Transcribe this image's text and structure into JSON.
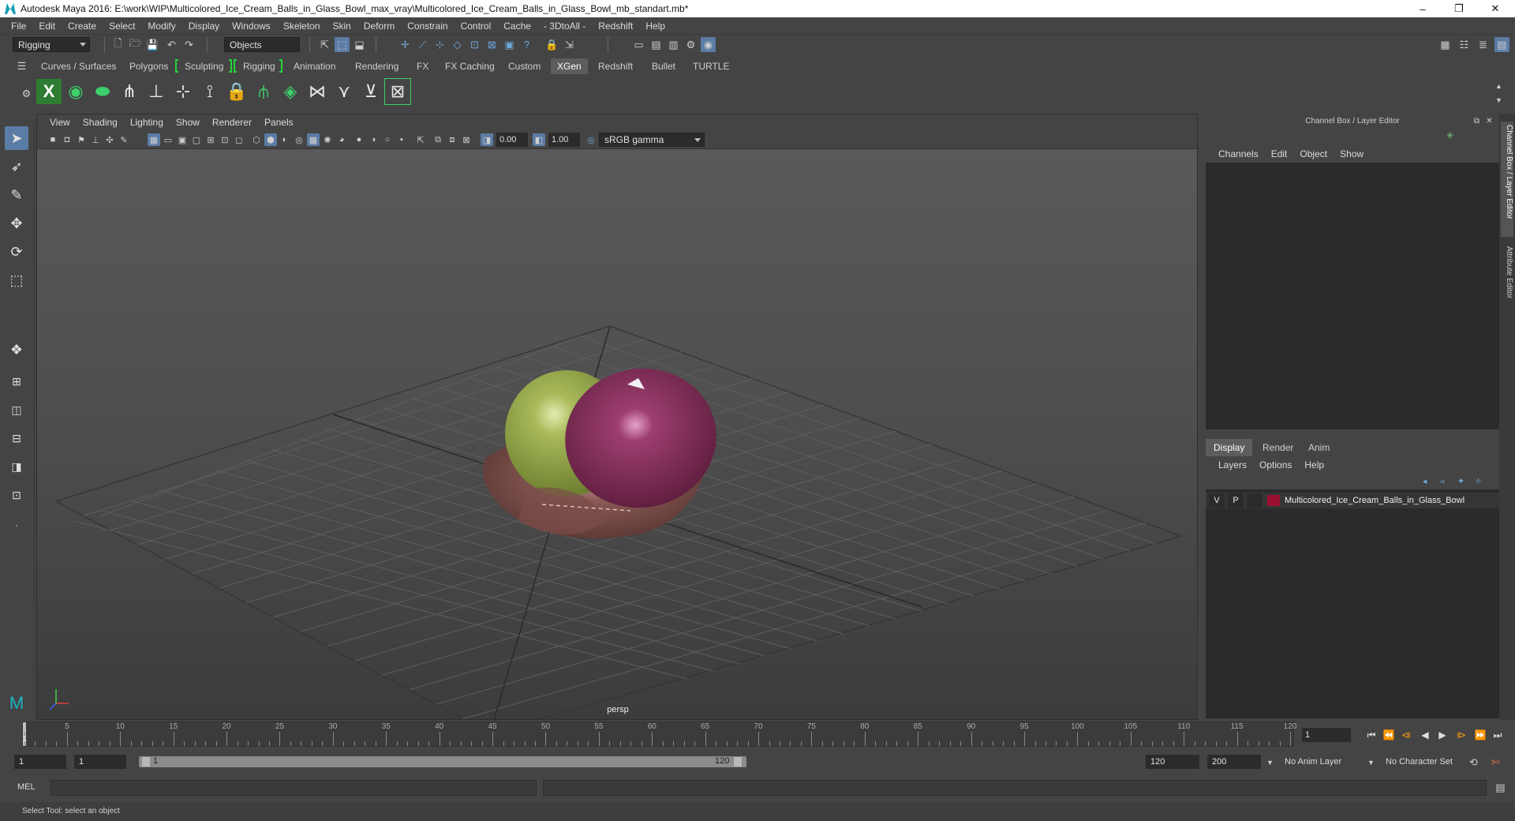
{
  "window": {
    "title": "Autodesk Maya 2016: E:\\work\\WIP\\Multicolored_Ice_Cream_Balls_in_Glass_Bowl_max_vray\\Multicolored_Ice_Cream_Balls_in_Glass_Bowl_mb_standart.mb*",
    "minimize": "–",
    "restore": "❐",
    "close": "✕"
  },
  "menubar": [
    "File",
    "Edit",
    "Create",
    "Select",
    "Modify",
    "Display",
    "Windows",
    "Skeleton",
    "Skin",
    "Deform",
    "Constrain",
    "Control",
    "Cache",
    "- 3DtoAll -",
    "Redshift",
    "Help"
  ],
  "statusline": {
    "menuset": "Rigging",
    "selection_mode": "Objects"
  },
  "shelf": {
    "tabs": [
      "Curves / Surfaces",
      "Polygons",
      "Sculpting",
      "Rigging",
      "Animation",
      "Rendering",
      "FX",
      "FX Caching",
      "Custom",
      "XGen",
      "Redshift",
      "Bullet",
      "TURTLE"
    ],
    "active_tab": "XGen"
  },
  "viewport": {
    "menu": [
      "View",
      "Shading",
      "Lighting",
      "Show",
      "Renderer",
      "Panels"
    ],
    "exposure": "0.00",
    "gamma": "1.00",
    "color_space": "sRGB gamma",
    "camera": "persp"
  },
  "channel_box": {
    "title": "Channel Box / Layer Editor",
    "menu": [
      "Channels",
      "Edit",
      "Object",
      "Show"
    ],
    "layer_tabs": [
      "Display",
      "Render",
      "Anim"
    ],
    "active_layer_tab": "Display",
    "layer_menu": [
      "Layers",
      "Options",
      "Help"
    ],
    "layers": [
      {
        "visible": "V",
        "playback": "P",
        "color": "#9b1030",
        "name": "Multicolored_Ice_Cream_Balls_in_Glass_Bowl"
      }
    ]
  },
  "side_tabs": [
    "Channel Box / Layer Editor",
    "Attribute Editor"
  ],
  "timeline": {
    "ticks": [
      1,
      5,
      10,
      15,
      20,
      25,
      30,
      35,
      40,
      45,
      50,
      55,
      60,
      65,
      70,
      75,
      80,
      85,
      90,
      95,
      100,
      105,
      110,
      115,
      120
    ],
    "current_frame": "1",
    "range_start": "1",
    "range_start_inner": "1",
    "range_slider_start": "1",
    "range_slider_end": "120",
    "range_end": "120",
    "anim_end": "200",
    "anim_layer": "No Anim Layer",
    "character_set": "No Character Set"
  },
  "commandline": {
    "label": "MEL"
  },
  "helpline": {
    "text": "Select Tool: select an object"
  },
  "icons": {
    "select_tool": "arrow-icon",
    "lasso_tool": "lasso-icon",
    "paint_tool": "paint-brush-icon",
    "move_tool": "move-icon",
    "rotate_tool": "rotate-icon",
    "scale_tool": "scale-icon"
  }
}
